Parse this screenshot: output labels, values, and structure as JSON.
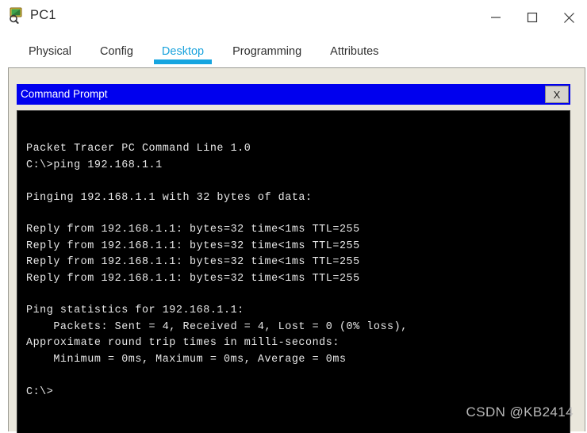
{
  "window": {
    "title": "PC1",
    "icon": "pc-device-icon",
    "controls": [
      {
        "name": "minimize",
        "glyph": "minimize-icon"
      },
      {
        "name": "maximize",
        "glyph": "maximize-icon"
      },
      {
        "name": "close",
        "glyph": "close-icon"
      }
    ]
  },
  "tabs": [
    {
      "label": "Physical",
      "active": false
    },
    {
      "label": "Config",
      "active": false
    },
    {
      "label": "Desktop",
      "active": true
    },
    {
      "label": "Programming",
      "active": false
    },
    {
      "label": "Attributes",
      "active": false
    }
  ],
  "command_prompt": {
    "title": "Command Prompt",
    "close_label": "X",
    "lines": [
      "",
      "Packet Tracer PC Command Line 1.0",
      "C:\\>ping 192.168.1.1",
      "",
      "Pinging 192.168.1.1 with 32 bytes of data:",
      "",
      "Reply from 192.168.1.1: bytes=32 time<1ms TTL=255",
      "Reply from 192.168.1.1: bytes=32 time<1ms TTL=255",
      "Reply from 192.168.1.1: bytes=32 time<1ms TTL=255",
      "Reply from 192.168.1.1: bytes=32 time<1ms TTL=255",
      "",
      "Ping statistics for 192.168.1.1:",
      "    Packets: Sent = 4, Received = 4, Lost = 0 (0% loss),",
      "Approximate round trip times in milli-seconds:",
      "    Minimum = 0ms, Maximum = 0ms, Average = 0ms",
      "",
      "C:\\>"
    ]
  },
  "watermark": {
    "text": "CSDN @KB2414"
  },
  "colors": {
    "accent": "#16a5e0",
    "panel_bg": "#eae7dc",
    "cmd_titlebar": "#0000ee",
    "terminal_bg": "#000000",
    "terminal_fg": "#e8e8e8"
  }
}
